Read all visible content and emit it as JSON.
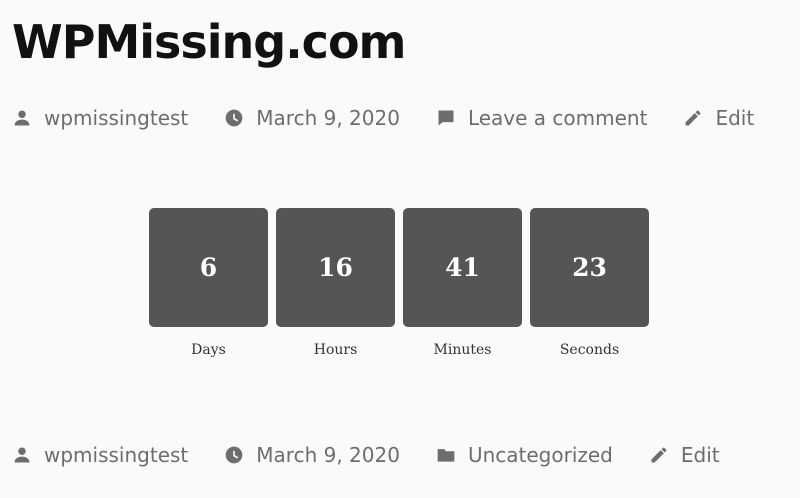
{
  "site": {
    "title": "WPMissing.com"
  },
  "top_meta": {
    "author": "wpmissingtest",
    "date": "March 9, 2020",
    "comment": "Leave a comment",
    "edit": "Edit"
  },
  "countdown": {
    "units": [
      {
        "value": "6",
        "label": "Days"
      },
      {
        "value": "16",
        "label": "Hours"
      },
      {
        "value": "41",
        "label": "Minutes"
      },
      {
        "value": "23",
        "label": "Seconds"
      }
    ]
  },
  "bottom_meta": {
    "author": "wpmissingtest",
    "date": "March 9, 2020",
    "category": "Uncategorized",
    "edit": "Edit"
  },
  "icons": {
    "author": "person-icon",
    "date": "clock-icon",
    "comment": "comment-icon",
    "edit": "pencil-icon",
    "category": "folder-icon"
  },
  "colors": {
    "background": "#fafafa",
    "meta_text": "#6d6d6d",
    "countdown_box": "#555555",
    "countdown_text": "#ffffff"
  }
}
